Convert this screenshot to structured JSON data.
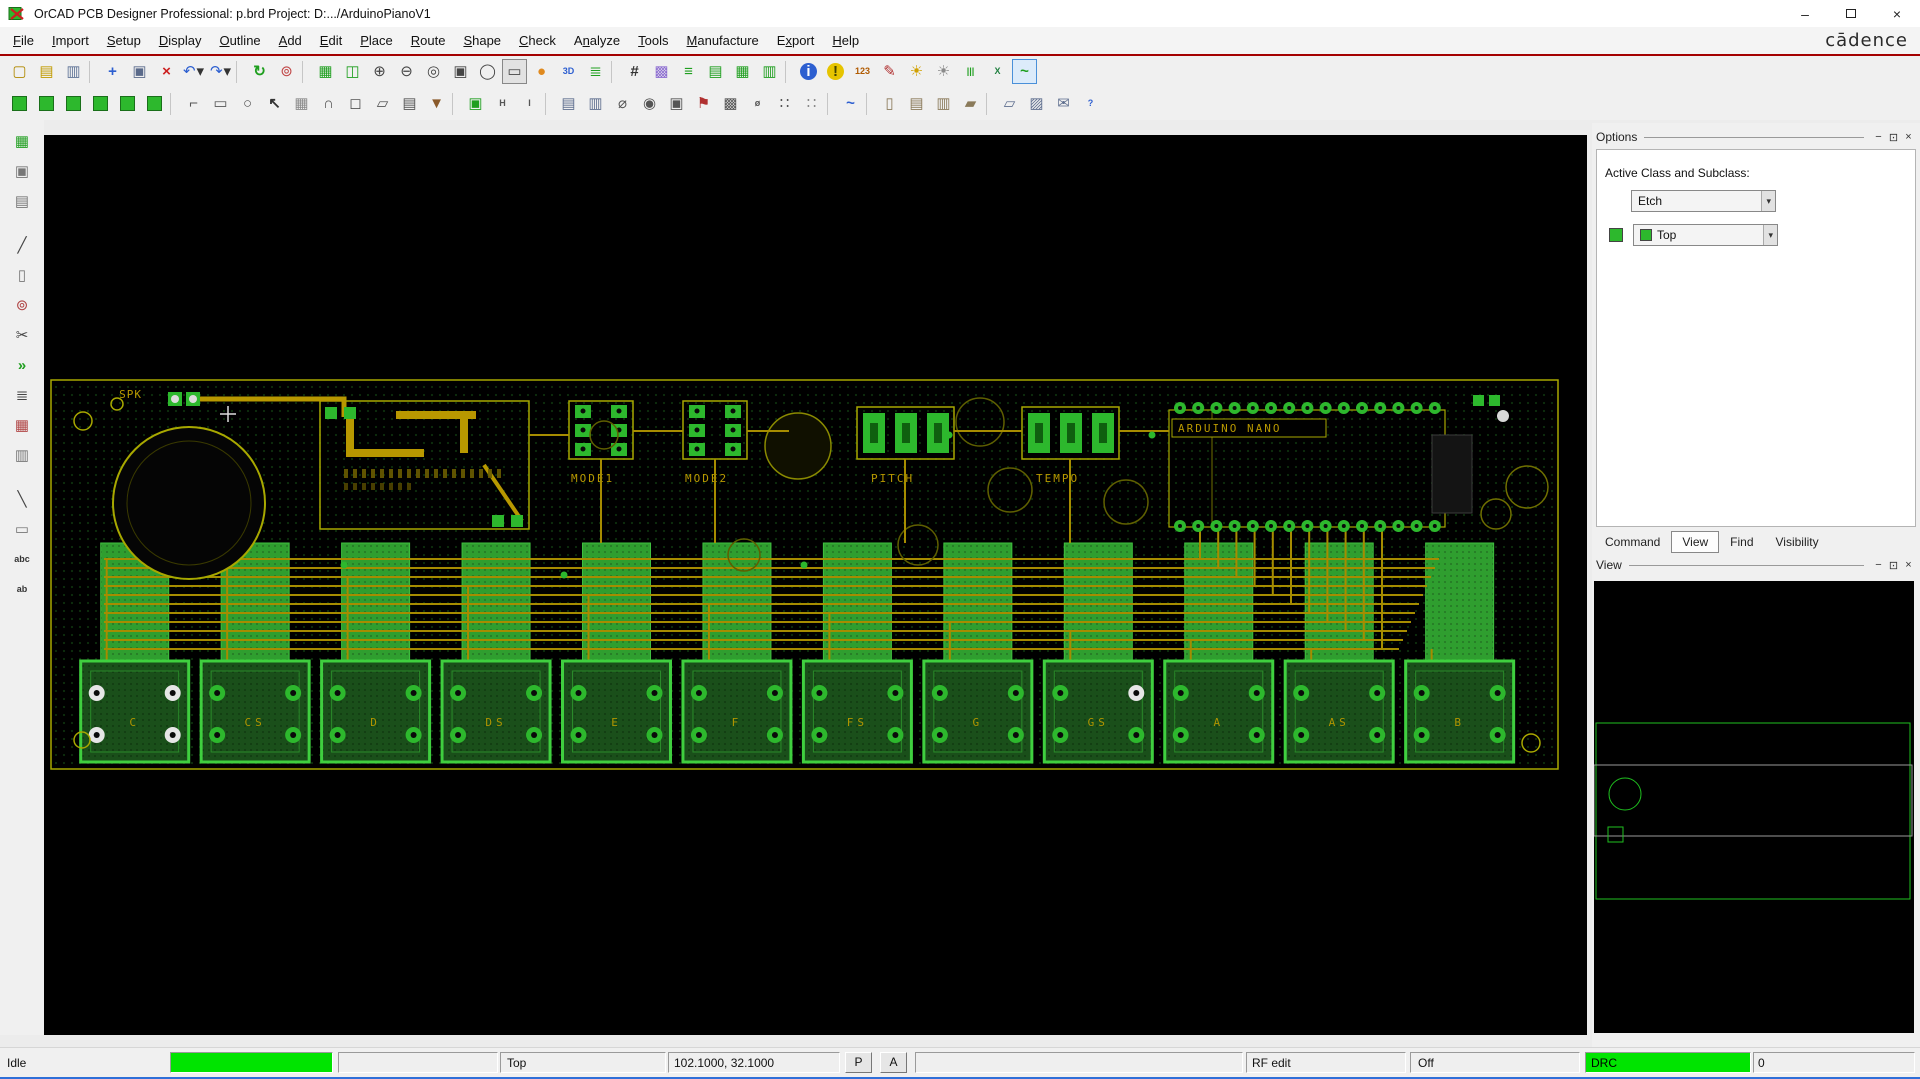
{
  "window": {
    "title": "OrCAD PCB Designer Professional: p.brd  Project: D:.../ArduinoPianoV1",
    "brand": "cādence",
    "controls": {
      "minimize": "–",
      "close": "×"
    }
  },
  "menu": {
    "items": [
      {
        "label": "File",
        "u": 0
      },
      {
        "label": "Import",
        "u": 0
      },
      {
        "label": "Setup",
        "u": 0
      },
      {
        "label": "Display",
        "u": 0
      },
      {
        "label": "Outline",
        "u": 0
      },
      {
        "label": "Add",
        "u": 0
      },
      {
        "label": "Edit",
        "u": 0
      },
      {
        "label": "Place",
        "u": 0
      },
      {
        "label": "Route",
        "u": 0
      },
      {
        "label": "Shape",
        "u": 0
      },
      {
        "label": "Check",
        "u": 0
      },
      {
        "label": "Analyze",
        "u": 1
      },
      {
        "label": "Tools",
        "u": 0
      },
      {
        "label": "Manufacture",
        "u": 0
      },
      {
        "label": "Export",
        "u": 1
      },
      {
        "label": "Help",
        "u": 0
      }
    ]
  },
  "toolbar1": [
    {
      "n": "new-file-icon",
      "g": "▢",
      "c": "#b08900"
    },
    {
      "n": "open-icon",
      "g": "▤",
      "c": "#c09a00"
    },
    {
      "n": "save-icon",
      "g": "▥",
      "c": "#5f7396"
    },
    {
      "sep": true
    },
    {
      "n": "move-icon",
      "g": "+",
      "c": "#2d5fd0",
      "b": 1
    },
    {
      "n": "copy-icon",
      "g": "▣",
      "c": "#5a6a8a"
    },
    {
      "n": "delete-icon",
      "g": "×",
      "c": "#cc1f1f",
      "b": 1
    },
    {
      "n": "undo-icon",
      "g": "↶",
      "c": "#2d5fd0",
      "caret": 1
    },
    {
      "n": "redo-icon",
      "g": "↷",
      "c": "#2d5fd0",
      "caret": 1
    },
    {
      "sep": true
    },
    {
      "n": "refresh-icon",
      "g": "↻",
      "c": "#1f9f1f",
      "b": 1
    },
    {
      "n": "pin-icon",
      "g": "⊚",
      "c": "#c04545"
    },
    {
      "sep": true
    },
    {
      "n": "windows-icon",
      "g": "▦",
      "c": "#1f9f1f"
    },
    {
      "n": "windows-2-icon",
      "g": "◫",
      "c": "#1f9f1f"
    },
    {
      "n": "zoom-in-icon",
      "g": "⊕",
      "c": "#454545"
    },
    {
      "n": "zoom-out-icon",
      "g": "⊖",
      "c": "#454545"
    },
    {
      "n": "zoom-previous-icon",
      "g": "◎",
      "c": "#454545"
    },
    {
      "n": "zoom-fit-icon",
      "g": "▣",
      "c": "#454545"
    },
    {
      "n": "zoom-world-icon",
      "g": "◯",
      "c": "#454545"
    },
    {
      "n": "zoom-selection-icon",
      "g": "▭",
      "c": "#454545",
      "framed": 1
    },
    {
      "n": "shaded-display-icon",
      "g": "●",
      "c": "#e08a1f"
    },
    {
      "n": "view-3d-icon",
      "g": "3D",
      "c": "#2d5fd0",
      "t": 1
    },
    {
      "n": "flip-design-icon",
      "g": "≣",
      "c": "#1f9f1f"
    },
    {
      "sep": true
    },
    {
      "n": "grid-icon",
      "g": "#",
      "c": "#333333",
      "b": 1
    },
    {
      "n": "color-dialog-icon",
      "g": "▩",
      "c": "#8a6ad0"
    },
    {
      "n": "cross-section-icon",
      "g": "≡",
      "c": "#1f9f1f",
      "b": 1
    },
    {
      "n": "constraint-manager-icon",
      "g": "▤",
      "c": "#1f9f1f"
    },
    {
      "n": "property-edit-icon",
      "g": "▦",
      "c": "#1f9f1f"
    },
    {
      "n": "component-browser-icon",
      "g": "▥",
      "c": "#1f9f1f"
    },
    {
      "sep": true
    },
    {
      "n": "info-icon",
      "g": "i",
      "bg": "#2d5fd0",
      "fg": "#ffffff"
    },
    {
      "n": "bulb-icon",
      "g": "!",
      "bg": "#e6c400",
      "fg": "#444400"
    },
    {
      "n": "numbers-icon",
      "g": "123",
      "c": "#b05a00",
      "t": 1
    },
    {
      "n": "brush-icon",
      "g": "✎",
      "c": "#b03030"
    },
    {
      "n": "sun-icon",
      "g": "☀",
      "c": "#d0a000"
    },
    {
      "n": "dim-icon",
      "g": "☀",
      "c": "#8a8a8a"
    },
    {
      "n": "stripes-icon",
      "g": "|||",
      "c": "#1f9f1f",
      "t": 1
    },
    {
      "n": "export-excel-icon",
      "g": "X",
      "c": "#1f7f3f",
      "t": 1
    },
    {
      "n": "waveform-icon",
      "g": "~",
      "c": "#1f9f1f",
      "b": 1,
      "sel": 1
    }
  ],
  "toolbar2": [
    {
      "n": "layer-swatch-1-icon",
      "sw": "#2db82d"
    },
    {
      "n": "layer-swatch-2-icon",
      "sw": "#2db82d"
    },
    {
      "n": "layer-swatch-3-icon",
      "sw": "#2db82d"
    },
    {
      "n": "layer-swatch-4-icon",
      "sw": "#2db82d"
    },
    {
      "n": "layer-swatch-5-icon",
      "sw": "#2db82d"
    },
    {
      "n": "layer-swatch-6-icon",
      "sw": "#2db82d"
    },
    {
      "sep": true
    },
    {
      "n": "corner-tool-icon",
      "g": "⌐",
      "c": "#555555"
    },
    {
      "n": "rect-tool-icon",
      "g": "▭",
      "c": "#555555"
    },
    {
      "n": "circle-tool-icon",
      "g": "○",
      "c": "#555555"
    },
    {
      "n": "select-tool-icon",
      "g": "↖",
      "c": "#333333",
      "b": 1
    },
    {
      "n": "window-select-icon",
      "g": "▦",
      "c": "#8a8a8a"
    },
    {
      "n": "arc-tool-icon",
      "g": "∩",
      "c": "#555555"
    },
    {
      "n": "slot-tool-icon",
      "g": "◻",
      "c": "#555555"
    },
    {
      "n": "poly-tool-icon",
      "g": "▱",
      "c": "#555555"
    },
    {
      "n": "layers-tool-icon",
      "g": "▤",
      "c": "#555555"
    },
    {
      "n": "stamp-tool-icon",
      "g": "▼",
      "c": "#8a5a2a"
    },
    {
      "sep": true
    },
    {
      "n": "place-part-icon",
      "g": "▣",
      "c": "#1f9f1f"
    },
    {
      "n": "ratsnest-h-icon",
      "g": "H",
      "c": "#555555",
      "t": 1
    },
    {
      "n": "ratsnest-i-icon",
      "g": "I",
      "c": "#555555",
      "t": 1
    },
    {
      "sep": true
    },
    {
      "n": "odb-export-icon",
      "g": "▤",
      "c": "#5f6f8f"
    },
    {
      "n": "artwork-icon",
      "g": "▥",
      "c": "#5f6f8f"
    },
    {
      "n": "drill-legend-icon",
      "g": "⌀",
      "c": "#555555"
    },
    {
      "n": "probe-icon",
      "g": "◉",
      "c": "#555555"
    },
    {
      "n": "snapshot-icon",
      "g": "▣",
      "c": "#555555"
    },
    {
      "n": "flag-icon",
      "g": "⚑",
      "c": "#b03030"
    },
    {
      "n": "checker-icon",
      "g": "▩",
      "c": "#555555"
    },
    {
      "n": "via-icon",
      "g": "ø",
      "c": "#555555",
      "t": 1
    },
    {
      "n": "grid-dots-icon",
      "g": "∷",
      "c": "#555555"
    },
    {
      "n": "grid-dots-2-icon",
      "g": "∷",
      "c": "#8a8a8a"
    },
    {
      "sep": true
    },
    {
      "n": "signal-wave-icon",
      "g": "~",
      "c": "#2d5fd0",
      "b": 1
    },
    {
      "sep": true
    },
    {
      "n": "clipboard-icon",
      "g": "▯",
      "c": "#8a7a5a"
    },
    {
      "n": "report-icon",
      "g": "▤",
      "c": "#8a7a5a"
    },
    {
      "n": "report-2-icon",
      "g": "▥",
      "c": "#8a7a5a"
    },
    {
      "n": "eraser-icon",
      "g": "▰",
      "c": "#8a7a5a"
    },
    {
      "sep": true
    },
    {
      "n": "export-design-icon",
      "g": "▱",
      "c": "#5f6f8f"
    },
    {
      "n": "image-export-icon",
      "g": "▨",
      "c": "#5f6f8f"
    },
    {
      "n": "mail-icon",
      "g": "✉",
      "c": "#5f6f8f"
    },
    {
      "n": "help-icon",
      "g": "?",
      "c": "#2d5fd0",
      "t": 1
    }
  ],
  "left_rail": [
    {
      "n": "board-icon",
      "g": "▦",
      "c": "#1f9f1f"
    },
    {
      "n": "module-icon",
      "g": "▣",
      "c": "#777777"
    },
    {
      "n": "ruler-icon",
      "g": "▤",
      "c": "#777777"
    },
    {
      "gap": true
    },
    {
      "n": "slide-icon",
      "g": "╱",
      "c": "#444444"
    },
    {
      "n": "clipboard-tool-icon",
      "g": "▯",
      "c": "#777777"
    },
    {
      "n": "pin-tool-icon",
      "g": "⊚",
      "c": "#b04545"
    },
    {
      "n": "cut-tool-icon",
      "g": "✂",
      "c": "#444444"
    },
    {
      "n": "chevrons-icon",
      "g": "»",
      "c": "#1f9f1f",
      "b": 1
    },
    {
      "n": "list-tool-icon",
      "g": "≣",
      "c": "#444444"
    },
    {
      "n": "palette-grid-icon",
      "g": "▦",
      "c": "#b04545"
    },
    {
      "n": "stackup-icon",
      "g": "▥",
      "c": "#777777"
    },
    {
      "gap": true
    },
    {
      "n": "line-tool-icon",
      "g": "╲",
      "c": "#444444"
    },
    {
      "n": "rect-draw-icon",
      "g": "▭",
      "c": "#777777"
    },
    {
      "n": "text-abc-icon",
      "g": "abc",
      "c": "#333333",
      "t": 1
    },
    {
      "n": "text-ab-icon",
      "g": "ab",
      "c": "#333333",
      "t": 1
    }
  ],
  "options_panel": {
    "title": "Options",
    "active_class_label": "Active Class and Subclass:",
    "class_value": "Etch",
    "subclass_value": "Top"
  },
  "panel_controls": {
    "minimize": "−",
    "float": "⊡",
    "close": "×"
  },
  "tabs": {
    "items": [
      "Command",
      "View",
      "Find",
      "Visibility"
    ],
    "active": "View"
  },
  "view_panel": {
    "title": "View"
  },
  "statusbar": {
    "state": "Idle",
    "layer": "Top",
    "coords": "102.1000, 32.1000",
    "btn_p": "P",
    "btn_a": "A",
    "rf": "RF edit",
    "off": "Off",
    "drc": "DRC",
    "drc_value": "0"
  },
  "pcb": {
    "labels": {
      "spk": "SPK",
      "mode1": "MODE1",
      "mode2": "MODE2",
      "pitch": "PITCH",
      "tempo": "TEMPO",
      "nano": "ARDUINO NANO"
    },
    "keys": [
      "C",
      "CS",
      "D",
      "DS",
      "E",
      "F",
      "FS",
      "G",
      "GS",
      "A",
      "AS",
      "B"
    ]
  },
  "colors": {
    "etch_green": "#2db82d",
    "trace_yellow": "#a68c00",
    "status_green": "#00e400",
    "menu_rule_red": "#a40000"
  }
}
